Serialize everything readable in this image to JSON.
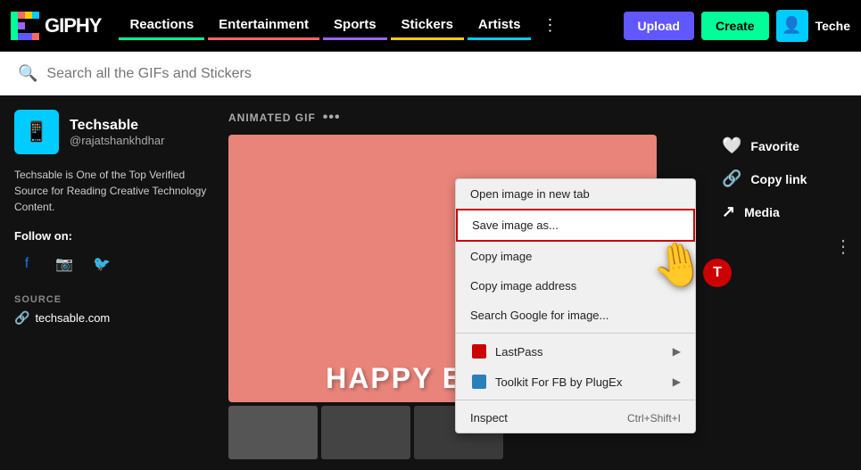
{
  "header": {
    "logo_text": "GIPHY",
    "nav": {
      "reactions": "Reactions",
      "entertainment": "Entertainment",
      "sports": "Sports",
      "stickers": "Stickers",
      "artists": "Artists"
    },
    "upload_label": "Upload",
    "create_label": "Create",
    "user_label": "Teche"
  },
  "search": {
    "placeholder": "Search all the GIFs and Stickers"
  },
  "sidebar": {
    "profile_name": "Techsable",
    "profile_handle": "@rajatshankhdhar",
    "profile_desc": "Techsable is One of the Top Verified Source for Reading Creative Technology Content.",
    "follow_label": "Follow on:",
    "source_label": "SOURCE",
    "source_url": "techsable.com"
  },
  "gif_area": {
    "label": "ANIMATED GIF",
    "happy_birthday_text": "HAPPY BIRTHE"
  },
  "action_panel": {
    "favorite_label": "Favorite",
    "copy_link_label": "Copy link",
    "media_label": "Media"
  },
  "context_menu": {
    "items": [
      {
        "id": "open-new-tab",
        "label": "Open image in new tab",
        "shortcut": "",
        "icon": "",
        "arrow": false
      },
      {
        "id": "save-image",
        "label": "Save image as...",
        "shortcut": "",
        "icon": "",
        "arrow": false,
        "highlighted": true
      },
      {
        "id": "copy-image",
        "label": "Copy image",
        "shortcut": "",
        "icon": "",
        "arrow": false
      },
      {
        "id": "copy-image-address",
        "label": "Copy image address",
        "shortcut": "",
        "icon": "",
        "arrow": false
      },
      {
        "id": "search-google",
        "label": "Search Google for image...",
        "shortcut": "",
        "icon": "",
        "arrow": false
      },
      {
        "id": "lastpass",
        "label": "LastPass",
        "shortcut": "",
        "icon": "lastpass",
        "arrow": true
      },
      {
        "id": "toolkit-fb",
        "label": "Toolkit For FB by PlugEx",
        "shortcut": "",
        "icon": "plugex",
        "arrow": true
      },
      {
        "id": "inspect",
        "label": "Inspect",
        "shortcut": "Ctrl+Shift+I",
        "icon": "",
        "arrow": false
      }
    ]
  },
  "colors": {
    "reactions_underline": "#00ff99",
    "entertainment_underline": "#ff6666",
    "sports_underline": "#9966ff",
    "stickers_underline": "#ffcc00",
    "artists_underline": "#00ccff"
  }
}
